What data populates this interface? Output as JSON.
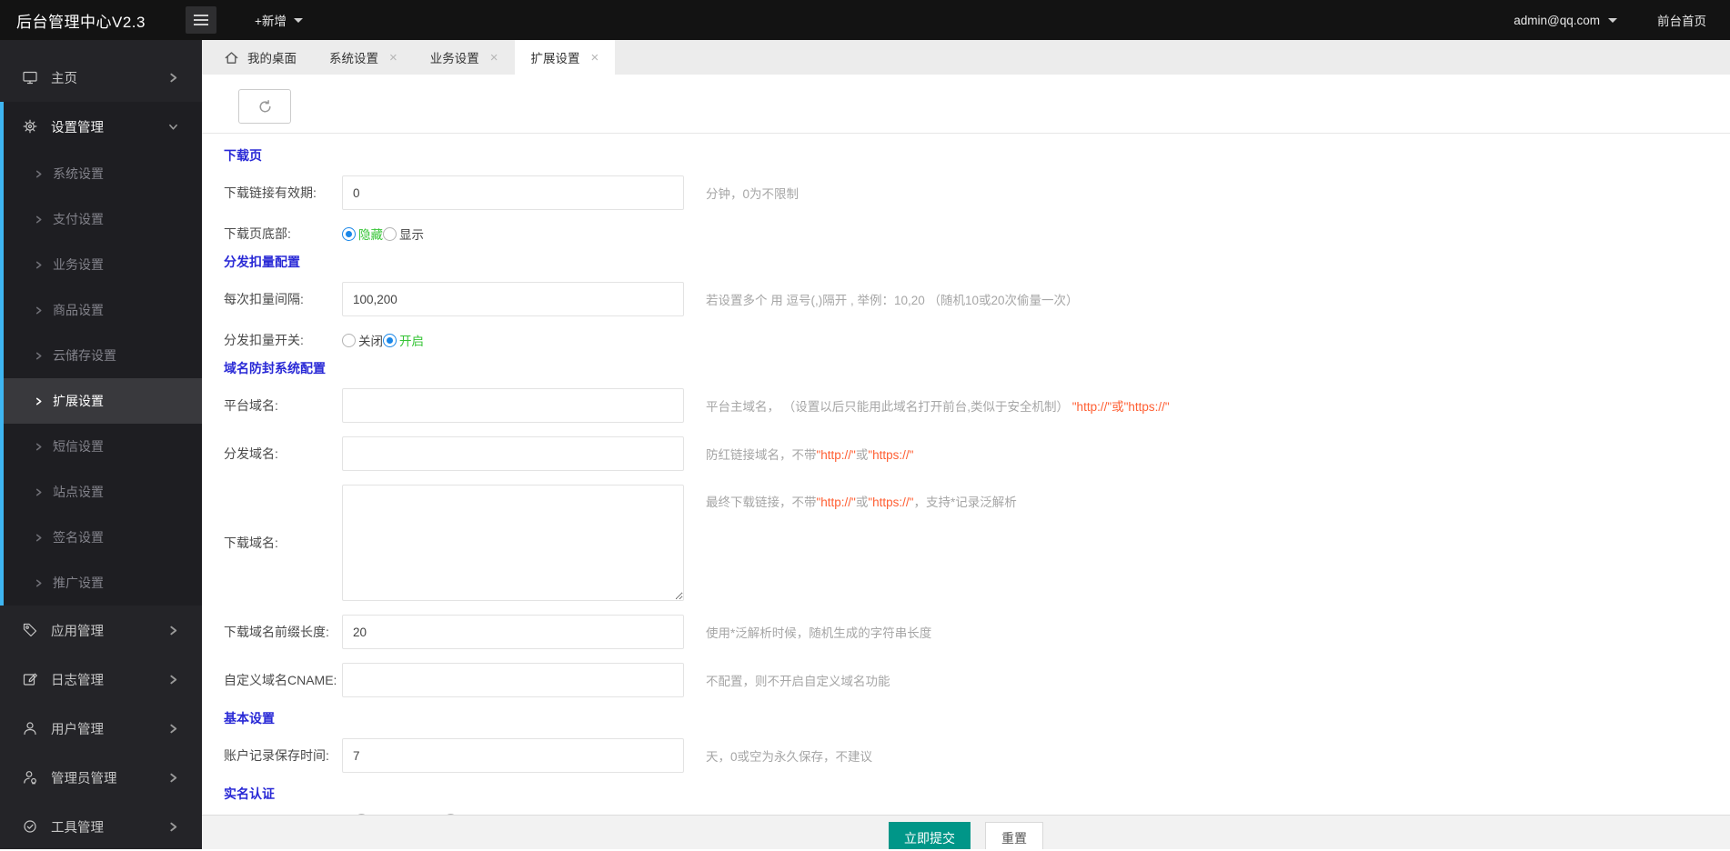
{
  "topbar": {
    "title": "后台管理中心V2.3",
    "new_button": "+新增",
    "user_email": "admin@qq.com",
    "frontend_link": "前台首页"
  },
  "sidebar": {
    "home": "主页",
    "settings_group": "设置管理",
    "submenu": [
      "系统设置",
      "支付设置",
      "业务设置",
      "商品设置",
      "云储存设置",
      "扩展设置",
      "短信设置",
      "站点设置",
      "签名设置",
      "推广设置"
    ],
    "active_submenu": "扩展设置",
    "bottom_items": [
      "应用管理",
      "日志管理",
      "用户管理",
      "管理员管理",
      "工具管理"
    ]
  },
  "tabs": {
    "items": [
      {
        "label": "我的桌面"
      },
      {
        "label": "系统设置"
      },
      {
        "label": "业务设置"
      },
      {
        "label": "扩展设置"
      }
    ],
    "active": "扩展设置",
    "close_glyph": "×"
  },
  "form": {
    "sections": {
      "download_page": "下载页",
      "deduction": "分发扣量配置",
      "domain_block": "域名防封系统配置",
      "basic": "基本设置",
      "realname": "实名认证"
    },
    "link_expiry": {
      "label": "下载链接有效期:",
      "value": "0",
      "hint": "分钟，0为不限制"
    },
    "page_footer": {
      "label": "下载页底部:",
      "option_hide": "隐藏",
      "option_show": "显示",
      "selected": "隐藏"
    },
    "deduct_interval": {
      "label": "每次扣量间隔:",
      "value": "100,200",
      "hint": "若设置多个 用 逗号(,)隔开 , 举例：10,20 （随机10或20次偷量一次）"
    },
    "deduct_switch": {
      "label": "分发扣量开关:",
      "option_off": "关闭",
      "option_on": "开启",
      "selected": "开启"
    },
    "platform_domain": {
      "label": "平台域名:",
      "value": "",
      "hint_text": "平台主域名， （设置以后只能用此域名打开前台,类似于安全机制） ",
      "hint_orange": "\"http://\"或\"https://\""
    },
    "dispatch_domain": {
      "label": "分发域名:",
      "value": "",
      "hint_text": "防红链接域名，不带",
      "hint_orange1": "\"http://\"",
      "hint_mid": "或",
      "hint_orange2": "\"https://\""
    },
    "download_domain": {
      "label": "下载域名:",
      "value": "",
      "hint_text": "最终下载链接，不带",
      "hint_orange1": "\"http://\"",
      "hint_mid": "或",
      "hint_orange2": "\"https://\"",
      "hint_post": "，支持*记录泛解析"
    },
    "prefix_length": {
      "label": "下载域名前缀长度:",
      "value": "20",
      "hint": "使用*泛解析时候，随机生成的字符串长度"
    },
    "cname": {
      "label": "自定义域名CNAME:",
      "value": "",
      "hint": "不配置，则不开启自定义域名功能"
    },
    "account_retention": {
      "label": "账户记录保存时间:",
      "value": "7",
      "hint": "天，0或空为永久保存，不建议"
    }
  },
  "footer": {
    "submit": "立即提交",
    "reset": "重置"
  },
  "colors": {
    "topbar_bg": "#131313",
    "sidebar_bg": "#242428",
    "sidebar_active_bg": "#39393d",
    "sidebar_accent_blue": "#3eb5f1",
    "heading_blue": "#2929d6",
    "radio_checked_blue": "#1a87e8",
    "option_green": "#35c435",
    "hint_orange": "#ff5f33",
    "submit_teal": "#009688"
  }
}
